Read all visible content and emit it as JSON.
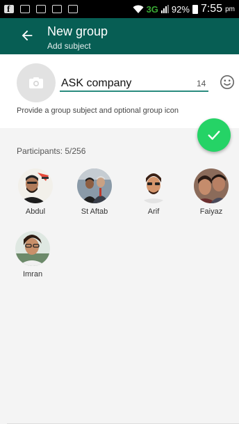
{
  "status_bar": {
    "network": "3G",
    "battery": "92%",
    "time": "7:55",
    "ampm": "pm"
  },
  "header": {
    "title": "New group",
    "subtitle": "Add subject"
  },
  "subject": {
    "value": "ASK company",
    "remaining_chars": "14",
    "helper": "Provide a group subject and optional group icon"
  },
  "participants": {
    "label": "Participants: 5/256",
    "people": [
      {
        "name": "Abdul"
      },
      {
        "name": "St Aftab"
      },
      {
        "name": "Arif"
      },
      {
        "name": "Faiyaz"
      },
      {
        "name": "Imran"
      }
    ]
  },
  "colors": {
    "header": "#075e54",
    "fab": "#25d366",
    "accent": "#2a8b7e"
  }
}
